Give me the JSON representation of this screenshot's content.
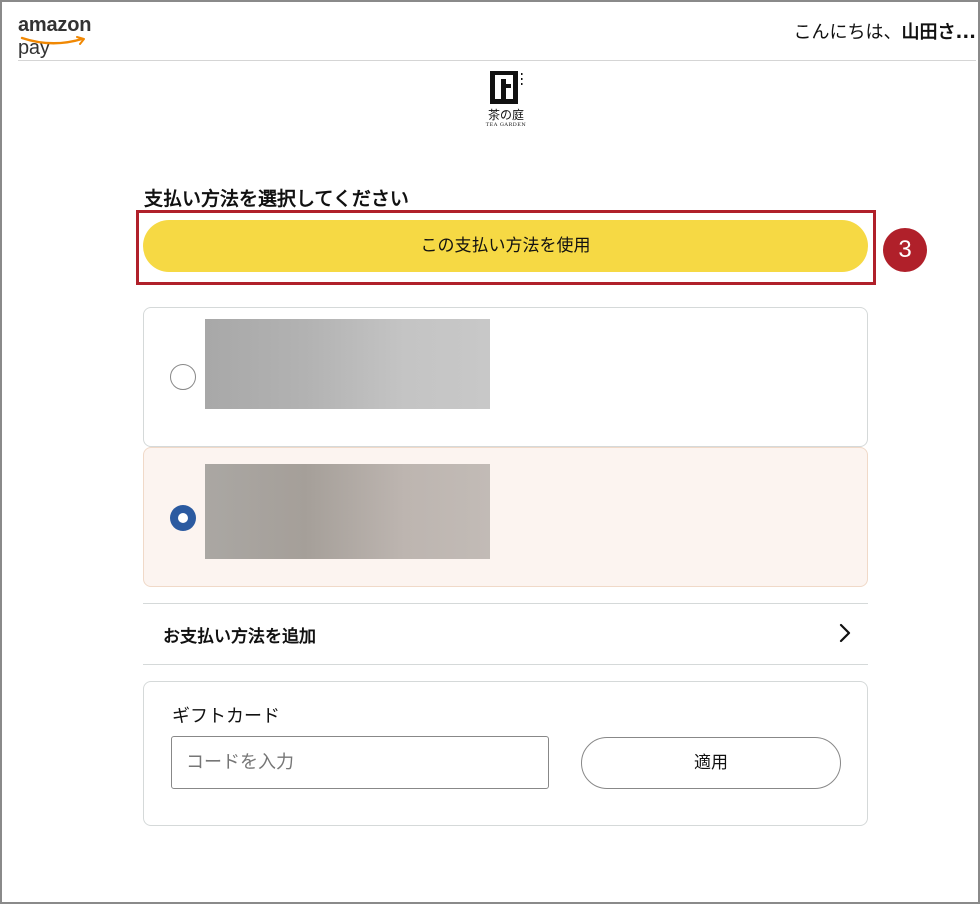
{
  "header": {
    "brand": {
      "amazon": "amazon",
      "pay": " pay"
    },
    "greeting_prefix": "こんにちは、",
    "greeting_name": "山田さ..."
  },
  "merchant": {
    "logo_mark": "上",
    "name": "茶の庭",
    "subtitle": "TEA GARDEN"
  },
  "payment": {
    "section_title": "支払い方法を選択してください",
    "use_button_label": "この支払い方法を使用",
    "step_badge": "3",
    "methods": [
      {
        "selected": false
      },
      {
        "selected": true
      }
    ],
    "add_method_label": "お支払い方法を追加"
  },
  "gift_card": {
    "title": "ギフトカード",
    "code_placeholder": "コードを入力",
    "code_value": "",
    "apply_label": "適用"
  },
  "colors": {
    "primary_button": "#f6d944",
    "highlight": "#b0202a",
    "radio_selected": "#2b5aa0",
    "selected_card_bg": "#fcf4f0",
    "smile": "#f08804"
  },
  "icons": {
    "chevron": "chevron-right-icon",
    "smile": "amazon-smile-icon"
  }
}
